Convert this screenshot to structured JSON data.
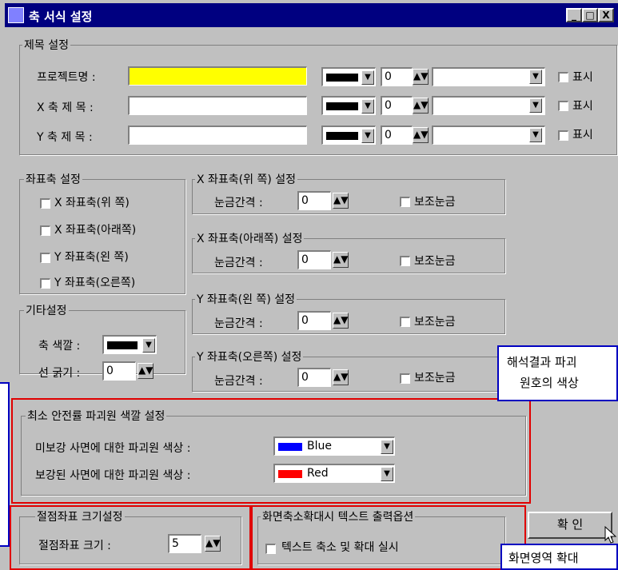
{
  "window": {
    "title": "축 서식 설정",
    "controls": [
      "_",
      "□",
      "X"
    ]
  },
  "title_group": {
    "label": "제목 설정",
    "rows": [
      {
        "label": "프로젝트명 :",
        "value": "",
        "size": "0",
        "font": "",
        "check_label": "표시",
        "highlight": "#ffff00"
      },
      {
        "label": "X 축 제 목 :",
        "value": "",
        "size": "0",
        "font": "",
        "check_label": "표시"
      },
      {
        "label": "Y 축 제 목 :",
        "value": "",
        "size": "0",
        "font": "",
        "check_label": "표시"
      }
    ]
  },
  "axis_group": {
    "label": "좌표축 설정",
    "items": [
      "X 좌표축(위  쪽)",
      "X 좌표축(아래쪽)",
      "Y 좌표축(왼  쪽)",
      "Y 좌표축(오른쪽)"
    ]
  },
  "etc_group": {
    "label": "기타설정",
    "axis_color_label": "축 색깔 :",
    "line_width_label": "선 굵기 :",
    "line_width_value": "0"
  },
  "axis_settings": [
    {
      "label": "X 좌표축(위 쪽) 설정",
      "interval_label": "눈금간격 :",
      "interval": "0",
      "minor_label": "보조눈금"
    },
    {
      "label": "X 좌표축(아래쪽) 설정",
      "interval_label": "눈금간격 :",
      "interval": "0",
      "minor_label": "보조눈금"
    },
    {
      "label": "Y 좌표축(왼  쪽) 설정",
      "interval_label": "눈금간격 :",
      "interval": "0",
      "minor_label": "보조눈금"
    },
    {
      "label": "Y 좌표축(오른쪽) 설정",
      "interval_label": "눈금간격 :",
      "interval": "0",
      "minor_label": "보조눈금"
    }
  ],
  "safety_group": {
    "label": "최소 안전률 파괴원 색깔 설정",
    "rows": [
      {
        "label": "미보강 사면에 대한 파괴원 색상 :",
        "value": "Blue",
        "color": "#0000ff"
      },
      {
        "label": "보강된 사면에 대한 파괴원 색상 :",
        "value": "Red",
        "color": "#ff0000"
      }
    ]
  },
  "node_group": {
    "label": "절점좌표 크기설정",
    "size_label": "절점좌표 크기 :",
    "size_value": "5"
  },
  "text_group": {
    "label": "화면축소확대시 텍스트 출력옵션",
    "check_label": "텍스트 축소 및 확대 실시"
  },
  "ok_button": {
    "label": "확  인"
  },
  "callouts": {
    "right_line1": "해석결과 파괴",
    "right_line2": "원호의 색상",
    "bottom": "화면영역 확대"
  },
  "colors": {
    "window_bg": "#c0c0c0",
    "titlebar": "#000080",
    "callout_border_red": "#e00000",
    "callout_border_blue": "#0000c0"
  }
}
